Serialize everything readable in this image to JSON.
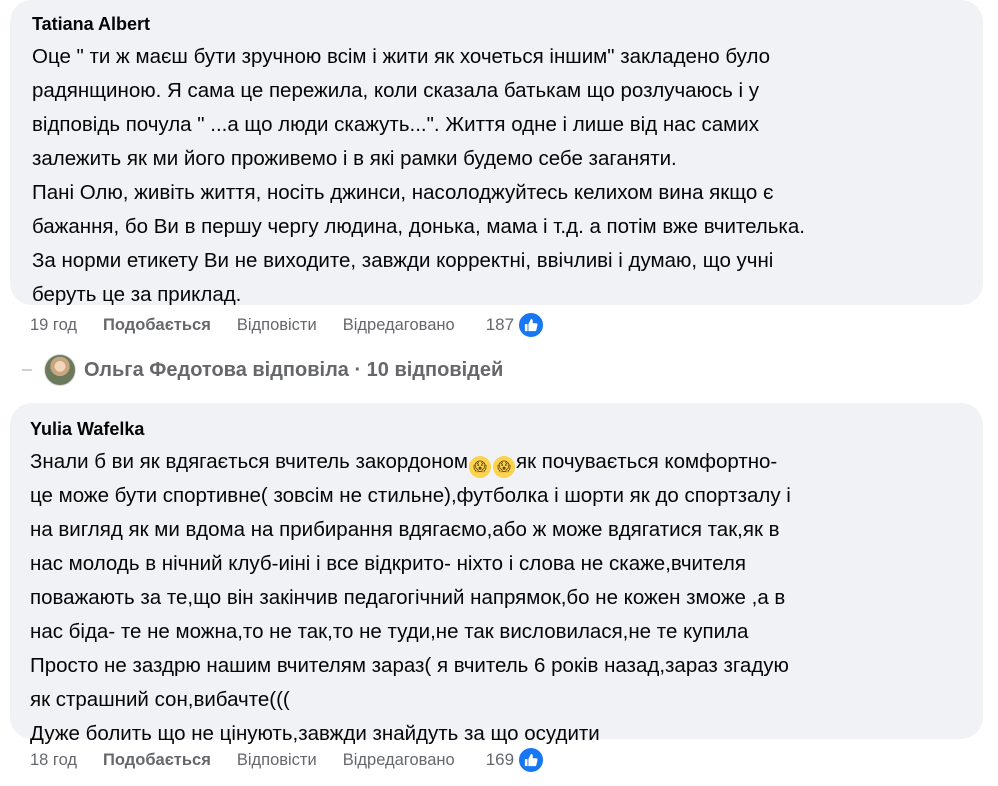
{
  "comment1": {
    "author": "Tatiana Albert",
    "lines": [
      "Оце \" ти ж маєш бути зручною всім і жити як хочеться іншим\" закладено було",
      "радянщиною. Я сама це пережила, коли сказала батькам що розлучаюсь і у",
      "відповідь почула \" ...а що люди скажуть...\". Життя одне і лише від нас самих",
      "залежить як ми його проживемо і в які рамки будемо себе заганяти.",
      "Пані Олю, живіть життя, носіть джинси, насолоджуйтесь келихом вина якщо є",
      "бажання, бо Ви в першу чергу людина, донька, мама і т.д. а потім вже вчителька.",
      "За норми етикету Ви не виходите, завжди корректні, ввічливі і думаю, що учні",
      "беруть це за приклад."
    ],
    "time": "19 год",
    "like_label": "Подобається",
    "reply_label": "Відповісти",
    "edited_label": "Відредаговано",
    "reaction_count": "187"
  },
  "replies_summary": {
    "text": "Ольга Федотова відповіла · 10 відповідей"
  },
  "comment2": {
    "author": "Yulia Wafelka",
    "line1_a": "Знали б ви як вдягається вчитель закордоном",
    "line1_b": "як почувається комфортно-",
    "lines": [
      "це може бути спортивне( зовсім не стильне),футболка і шорти як до спортзалу і",
      "на вигляд як ми вдома на прибирання вдягаємо,або ж може вдягатися так,як в",
      "нас молодь в нічний клуб-иіні і все відкрито- ніхто і слова не скаже,вчителя",
      "поважають за те,що він закінчив педагогічний напрямок,бо не кожен зможе ,а в",
      "нас біда- те не можна,то не так,то не туди,не так висловилася,не те купила",
      "Просто не заздрю нашим вчителям зараз( я вчитель 6 років назад,зараз згадую",
      "як страшний сон,вибачте(((",
      "Дуже болить що не цінують,завжди знайдуть за що осудити"
    ],
    "time": "18 год",
    "like_label": "Подобається",
    "reply_label": "Відповісти",
    "edited_label": "Відредаговано",
    "reaction_count": "169"
  },
  "icons": {
    "like": "thumbs-up-icon",
    "emoji": "scared-face-emoji-icon"
  },
  "colors": {
    "bubble_bg": "#f0f2f5",
    "secondary_text": "#65676b",
    "like_blue": "#1877f2"
  }
}
